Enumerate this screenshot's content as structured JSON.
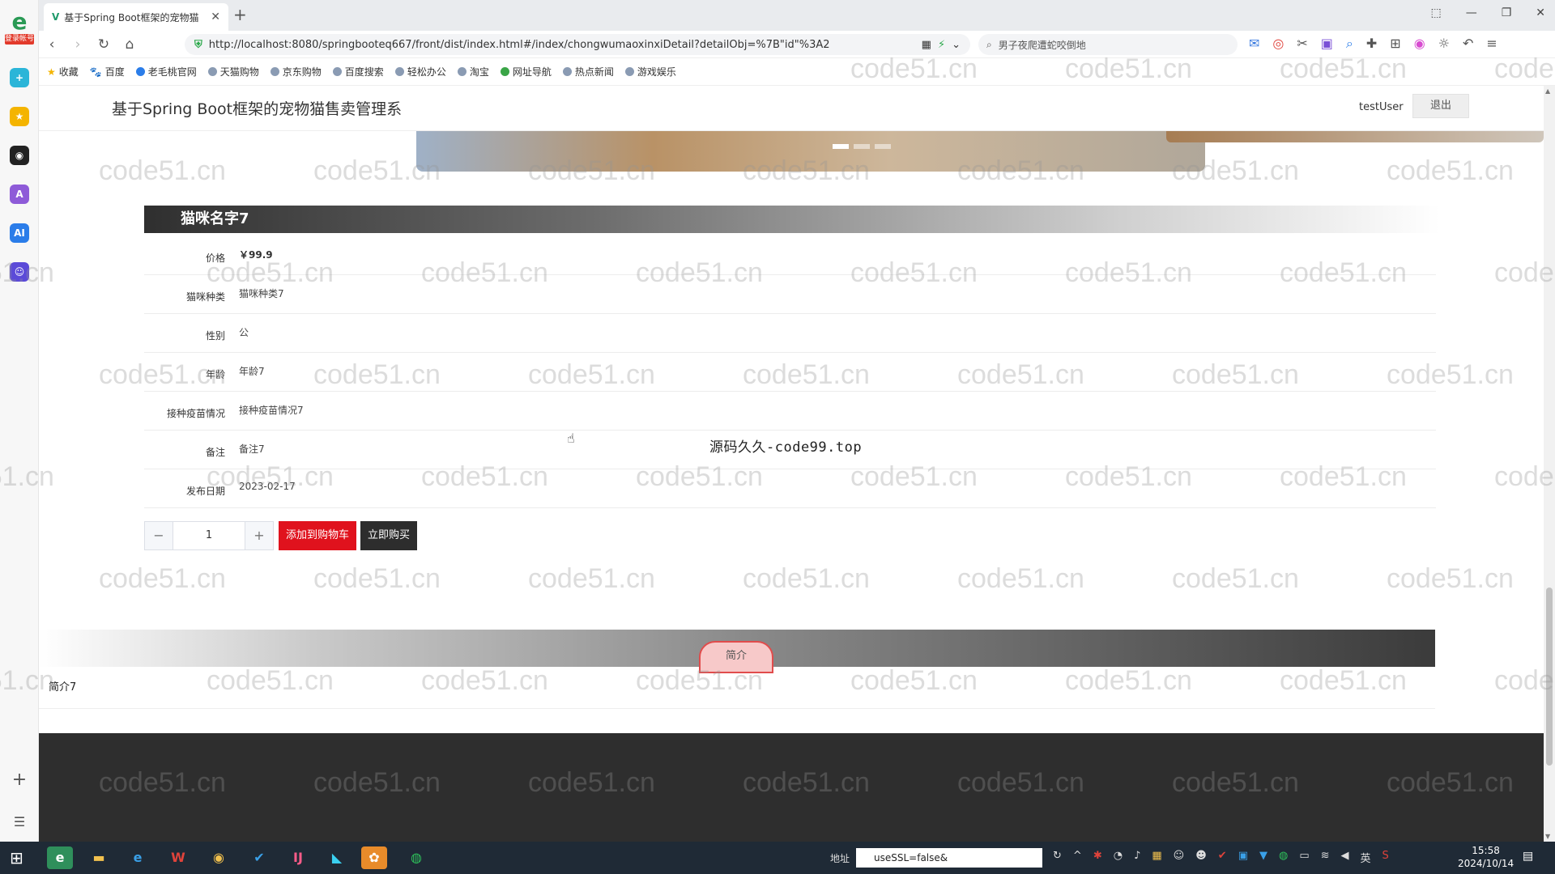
{
  "browser": {
    "sidebar_logo_badge": "登录帐号",
    "tab_title": "基于Spring Boot框架的宠物猫",
    "url": "http://localhost:8080/springbooteq667/front/dist/index.html#/index/chongwumaoxinxiDetail?detailObj=%7B\"id\"%3A2",
    "search_text": "男子夜爬遭蛇咬倒地",
    "bookmarks": [
      "收藏",
      "百度",
      "老毛桃官网",
      "天猫购物",
      "京东购物",
      "百度搜索",
      "轻松办公",
      "淘宝",
      "网址导航",
      "热点新闻",
      "游戏娱乐"
    ]
  },
  "site": {
    "title": "基于Spring Boot框架的宠物猫售卖管理系",
    "user": "testUser",
    "logout": "退出"
  },
  "product": {
    "name": "猫咪名字7",
    "fields": [
      {
        "label": "价格",
        "value": "￥99.9"
      },
      {
        "label": "猫咪种类",
        "value": "猫咪种类7"
      },
      {
        "label": "性别",
        "value": "公"
      },
      {
        "label": "年龄",
        "value": "年龄7"
      },
      {
        "label": "接种疫苗情况",
        "value": "接种疫苗情况7"
      },
      {
        "label": "备注",
        "value": "备注7"
      },
      {
        "label": "发布日期",
        "value": "2023-02-17"
      }
    ],
    "quantity": "1",
    "minus": "−",
    "plus": "+",
    "add_to_cart": "添加到购物车",
    "buy_now": "立即购买"
  },
  "intro": {
    "tab": "简介",
    "text": "简介7"
  },
  "overlay": {
    "source_mark": "源码久久-code99.top",
    "watermark": "code51.cn"
  },
  "taskbar": {
    "address_label": "地址",
    "address_value": "useSSL=false&",
    "time": "15:58",
    "date": "2024/10/14",
    "ime": "英"
  }
}
